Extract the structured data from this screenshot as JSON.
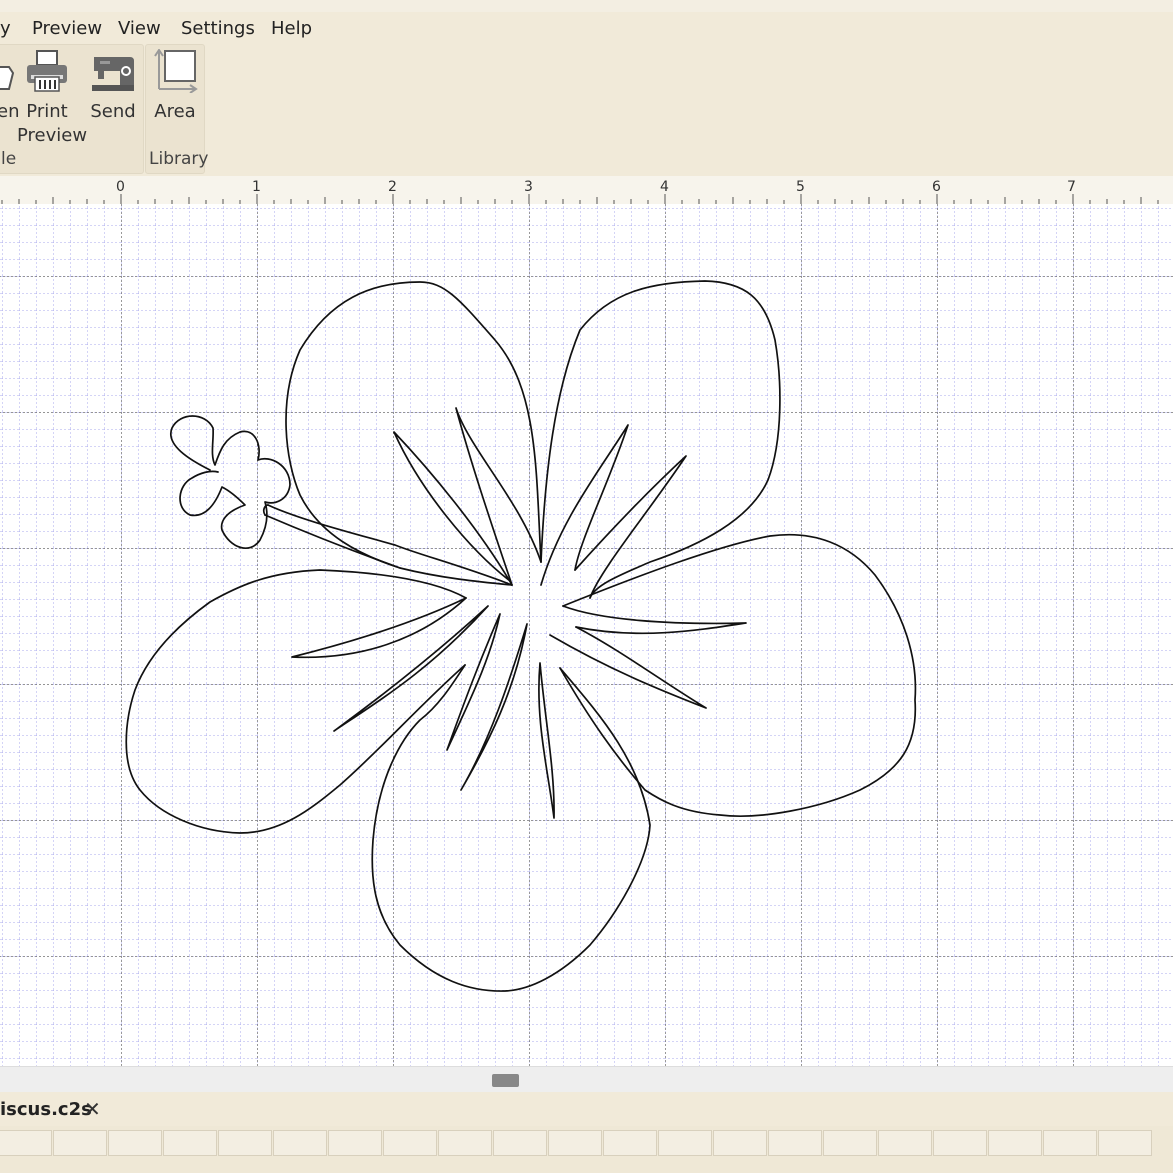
{
  "menubar": {
    "items": [
      "y",
      "Preview",
      "View",
      "Settings",
      "Help"
    ]
  },
  "ribbon": {
    "open_label": "en",
    "print_preview_label_1": "Print",
    "print_preview_label_2": "Preview",
    "send_label": "Send",
    "area_label": "Area",
    "file_group_label": "le",
    "library_group_label": "Library"
  },
  "ruler": {
    "labels": [
      "0",
      "1",
      "2",
      "3",
      "4",
      "5",
      "6",
      "7"
    ]
  },
  "document_tab": {
    "filename": "iscus.c2s",
    "close_symbol": "✕"
  },
  "colors": {
    "chrome_bg": "#f1ead9",
    "grid_major": "#555555",
    "grid_minor": "#aaaaee",
    "shape_stroke": "#111111"
  },
  "icons": [
    "open-folder-icon",
    "printer-icon",
    "sewing-machine-icon",
    "area-icon",
    "close-icon"
  ]
}
